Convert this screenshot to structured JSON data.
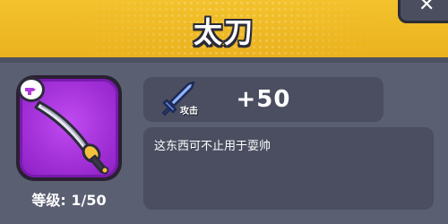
{
  "header": {
    "title": "太刀"
  },
  "close_button": {
    "label": "✕",
    "icon": "close-icon"
  },
  "item": {
    "icon": "curved-sword-icon",
    "tag_icon": "tag-icon",
    "level_text": "等级: 1/50",
    "rarity_color": "#a02fd6"
  },
  "stat": {
    "icon": "sword-attack-icon",
    "label": "攻击",
    "value": "+50"
  },
  "description": {
    "text": "这东西可不止用于耍帅"
  },
  "colors": {
    "header": "#f3c22c",
    "panel": "#5a5f72",
    "box": "#4a4e60"
  }
}
